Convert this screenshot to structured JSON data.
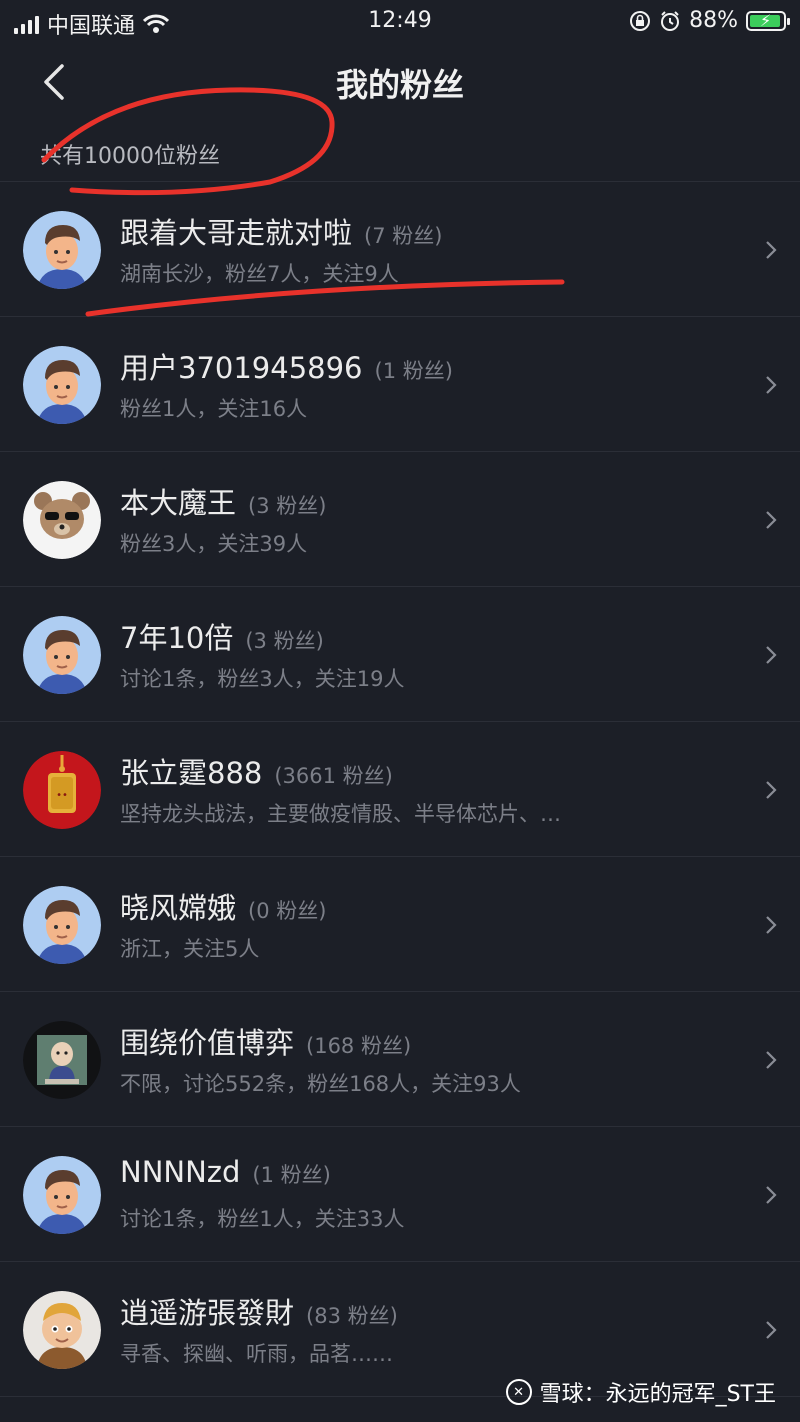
{
  "status": {
    "carrier": "中国联通",
    "time": "12:49",
    "battery": "88%",
    "battery_level": 0.88
  },
  "nav": {
    "title": "我的粉丝",
    "back_icon": "chevron-left-icon"
  },
  "summary": "共有10000位粉丝",
  "followers": [
    {
      "name": "跟着大哥走就对啦",
      "fans": "(7 粉丝)",
      "desc": "湖南长沙，粉丝7人，关注9人",
      "avatar": "cartoon-man"
    },
    {
      "name": "用户3701945896",
      "fans": "(1 粉丝)",
      "desc": "粉丝1人，关注16人",
      "avatar": "cartoon-man"
    },
    {
      "name": "本大魔王",
      "fans": "(3 粉丝)",
      "desc": "粉丝3人，关注39人",
      "avatar": "bear"
    },
    {
      "name": "7年10倍",
      "fans": "(3 粉丝)",
      "desc": "讨论1条，粉丝3人，关注19人",
      "avatar": "cartoon-man"
    },
    {
      "name": "张立霆888",
      "fans": "(3661 粉丝)",
      "desc": "坚持龙头战法，主要做疫情股、半导体芯片、…",
      "avatar": "red-charm"
    },
    {
      "name": "晓风嫦娥",
      "fans": "(0 粉丝)",
      "desc": "浙江，关注5人",
      "avatar": "cartoon-man"
    },
    {
      "name": "围绕价值博弈",
      "fans": "(168 粉丝)",
      "desc": "不限，讨论552条，粉丝168人，关注93人",
      "avatar": "monk-figure"
    },
    {
      "name": "NNNNzd",
      "fans": "(1 粉丝)",
      "desc": "讨论1条，粉丝1人，关注33人",
      "avatar": "cartoon-man"
    },
    {
      "name": "逍遥游張發財",
      "fans": "(83 粉丝)",
      "desc": "寻香、探幽、听雨，品茗……",
      "avatar": "cartoon-monk"
    }
  ],
  "watermark": "雪球：永远的冠军_ST王",
  "colors": {
    "background": "#1c1f27",
    "annotation_red": "#e8322b",
    "battery_green": "#3ccd5b"
  }
}
